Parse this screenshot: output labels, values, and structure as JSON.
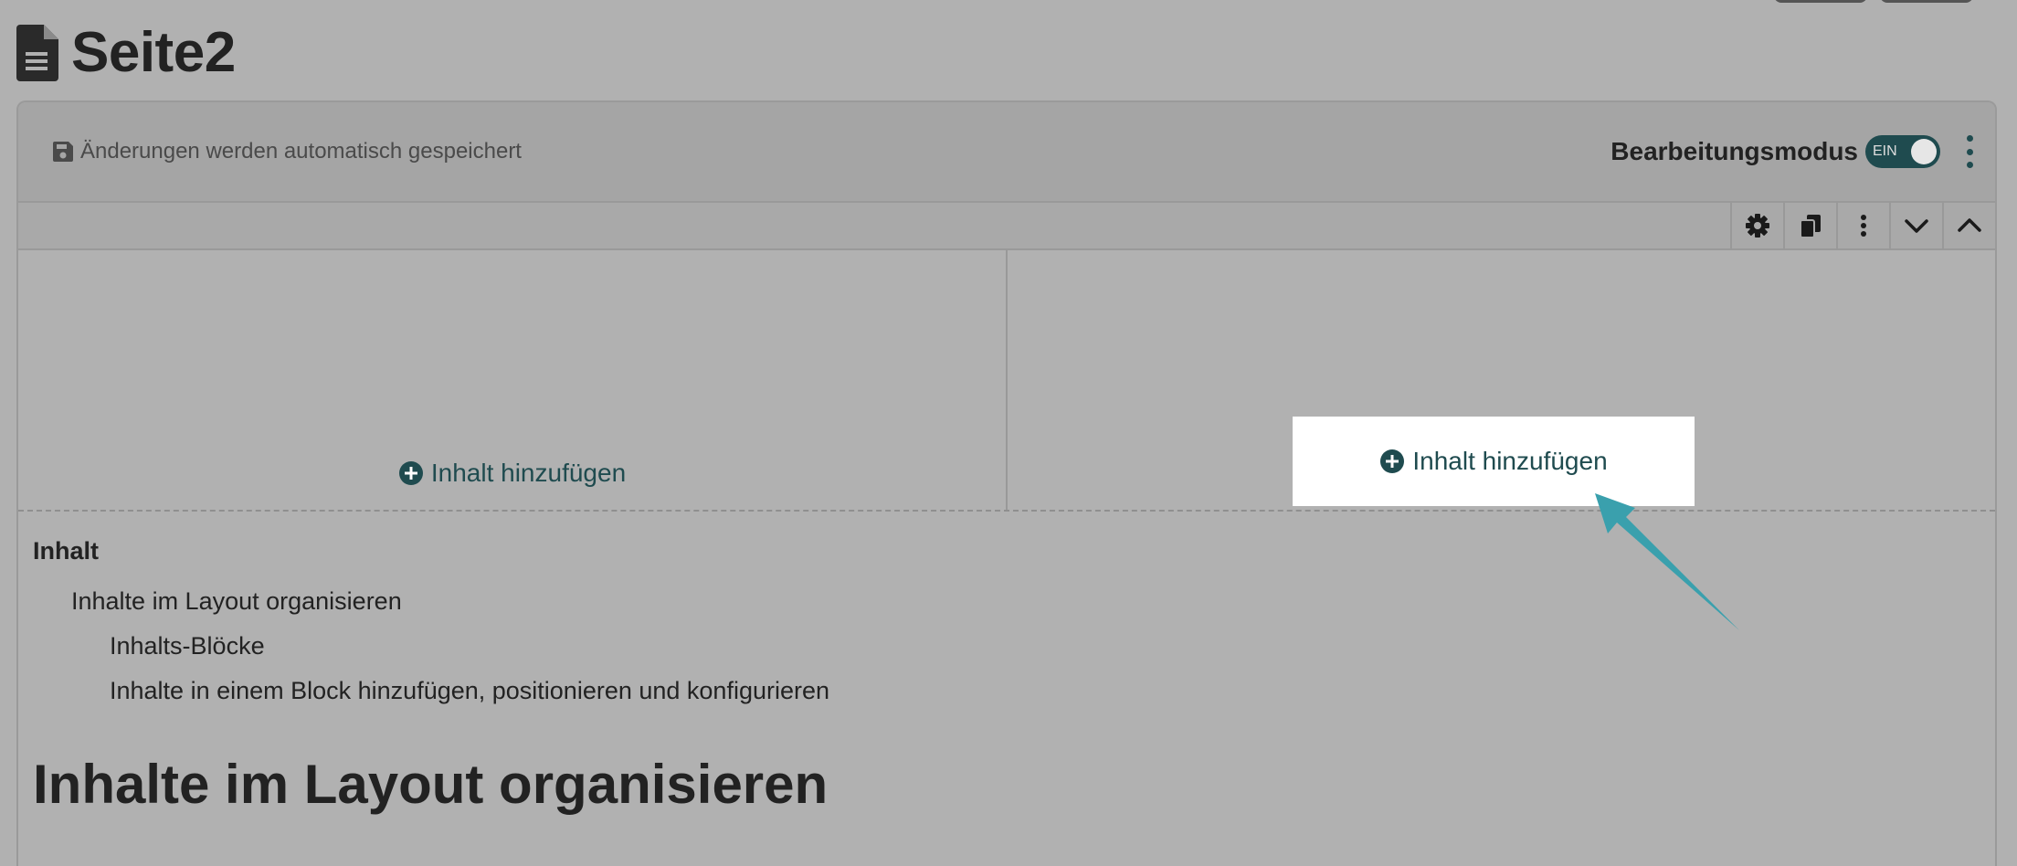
{
  "page": {
    "title": "Seite2"
  },
  "editor": {
    "autosave_text": "Änderungen werden automatisch gespeichert",
    "mode_label": "Bearbeitungsmodus",
    "mode_toggle_text": "EIN",
    "mode_on": true
  },
  "toolbar": {
    "icons": [
      "gear-icon",
      "copy-icon",
      "more-vertical-icon",
      "chevron-down-icon",
      "chevron-up-icon"
    ]
  },
  "columns": {
    "left_add_label": "Inhalt hinzufügen",
    "right_add_label": "Inhalt hinzufügen"
  },
  "toc": {
    "heading": "Inhalt",
    "items": [
      {
        "label": "Inhalte im Layout organisieren",
        "level": 1
      },
      {
        "label": "Inhalts-Blöcke",
        "level": 2
      },
      {
        "label": "Inhalte in einem Block hinzufügen, positionieren und konfigurieren",
        "level": 2
      }
    ]
  },
  "content": {
    "heading": "Inhalte im Layout organisieren"
  },
  "colors": {
    "accent": "#1f4b4f",
    "annotation_arrow": "#3aa0ad",
    "overlay_background": "#b1b1b1"
  }
}
